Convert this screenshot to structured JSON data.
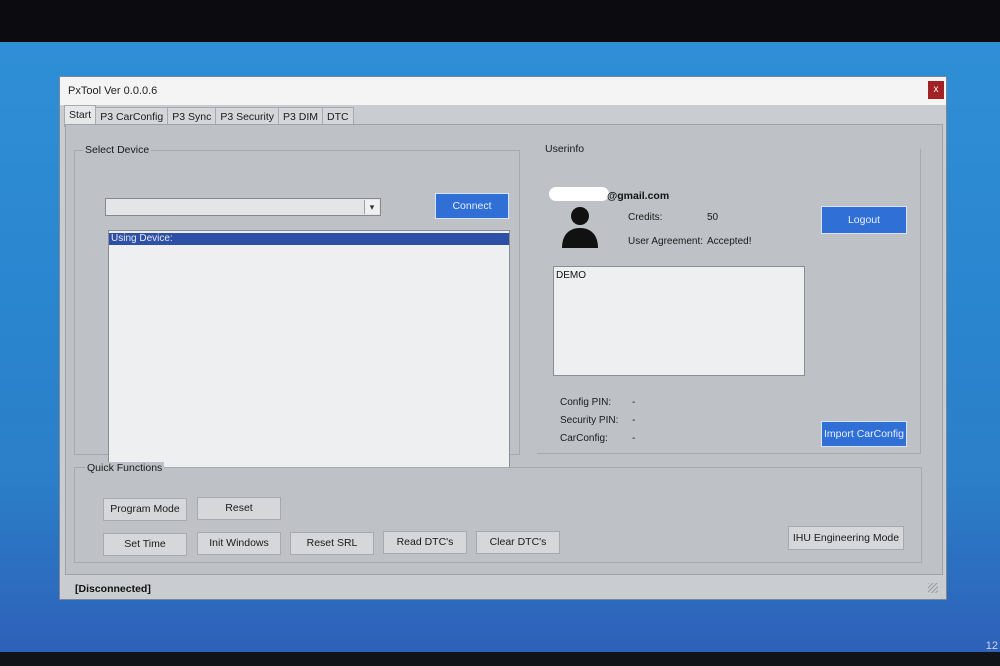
{
  "window": {
    "title": "PxTool Ver 0.0.0.6",
    "close_label": "x"
  },
  "tabs": [
    {
      "label": "Start"
    },
    {
      "label": "P3 CarConfig"
    },
    {
      "label": "P3 Sync"
    },
    {
      "label": "P3 Security"
    },
    {
      "label": "P3 DIM"
    },
    {
      "label": "DTC"
    }
  ],
  "select_device": {
    "group_label": "Select Device",
    "combo_value": "",
    "connect_label": "Connect",
    "list_items": [
      "Using Device:"
    ]
  },
  "userinfo": {
    "group_label": "Userinfo",
    "email_suffix": "@gmail.com",
    "credits_label": "Credits:",
    "credits_value": "50",
    "agreement_label": "User Agreement:",
    "agreement_value": "Accepted!",
    "logout_label": "Logout",
    "notes_value": "DEMO",
    "config_pin_label": "Config PIN:",
    "config_pin_value": "-",
    "security_pin_label": "Security PIN:",
    "security_pin_value": "-",
    "carconfig_label": "CarConfig:",
    "carconfig_value": "-",
    "import_label": "Import CarConfig"
  },
  "quick_functions": {
    "group_label": "Quick Functions",
    "program_mode": "Program Mode",
    "reset": "Reset",
    "set_time": "Set Time",
    "init_windows": "Init Windows",
    "reset_srl": "Reset SRL",
    "read_dtcs": "Read DTC's",
    "clear_dtcs": "Clear DTC's",
    "ihu_engineering": "IHU Engineering Mode"
  },
  "status": {
    "text": "[Disconnected]"
  },
  "taskbar": {
    "clock_fragment": "12"
  }
}
